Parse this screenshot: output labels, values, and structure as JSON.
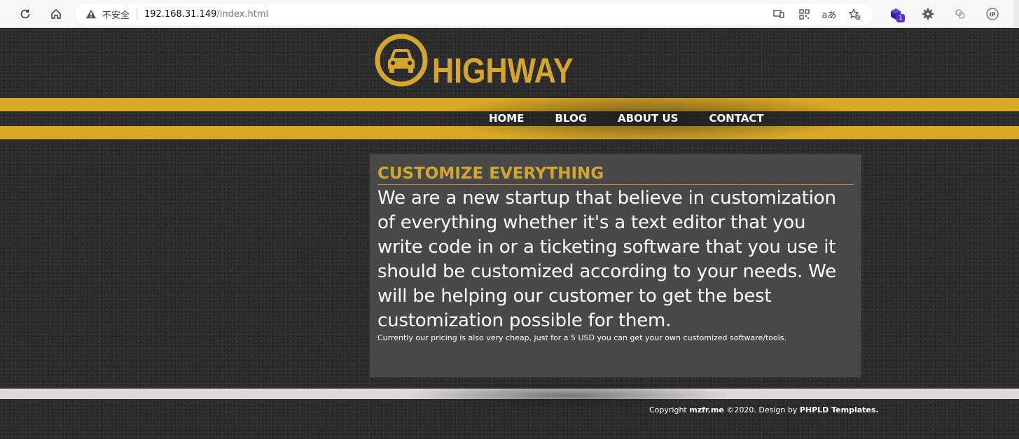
{
  "browser": {
    "insecure_label": "不安全",
    "url_host": "192.168.31.149",
    "url_path": "/index.html",
    "extension_badge": "1",
    "read_aloud_label": "aあ"
  },
  "site": {
    "logo_text": "HIGHWAY",
    "nav": [
      "HOME",
      "BLOG",
      "ABOUT US",
      "CONTACT"
    ],
    "content": {
      "title": "CUSTOMIZE EVERYTHING",
      "lead": "We are a new startup that believe in customization of everything whether it's a text editor that you write code in or a ticketing software that you use it should be customized according to your needs. We will be helping our customer to get the best customization possible for them.",
      "note": "Currently our pricing is also very cheap, just for a 5 USD you can get your own customized software/tools."
    },
    "footer": {
      "prefix": "Copyright ",
      "owner": "mzfr.me",
      "middle": " ©2020. Design by ",
      "designer": "PHPLD Templates."
    }
  },
  "colors": {
    "accent_yellow": "#d9a825",
    "title_yellow": "#d4a72c",
    "asphalt": "#2b2b2d",
    "panel": "#4e4e4e"
  }
}
